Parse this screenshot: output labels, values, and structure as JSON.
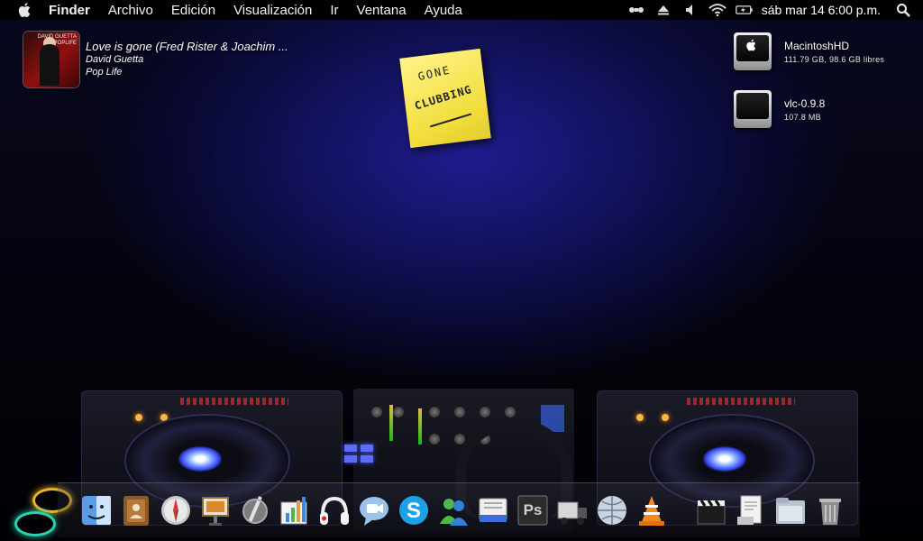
{
  "menubar": {
    "app_name": "Finder",
    "menus": [
      "Archivo",
      "Edición",
      "Visualización",
      "Ir",
      "Ventana",
      "Ayuda"
    ],
    "status_icons": [
      "bluetooth-icon",
      "eject-icon",
      "volume-icon",
      "wifi-icon",
      "battery-icon"
    ],
    "clock": "sáb mar 14  6:00 p.m."
  },
  "now_playing": {
    "title": "Love is gone (Fred Rister & Joachim ...",
    "artist": "David Guetta",
    "album": "Pop Life",
    "art_text": "DAVID GUETTA POPLIFE"
  },
  "sticky_note": {
    "line1": "GONE",
    "line2": "CLUBBING"
  },
  "drives": [
    {
      "name": "MacintoshHD",
      "detail": "111.79 GB, 98.6 GB libres"
    },
    {
      "name": "vlc-0.9.8",
      "detail": "107.8 MB"
    }
  ],
  "dock": {
    "items": [
      "finder-icon",
      "address-book-icon",
      "safari-icon",
      "keynote-icon",
      "script-editor-icon",
      "numbers-icon",
      "headphones-app-icon",
      "ichat-icon",
      "skype-icon",
      "messenger-icon",
      "mail-icon",
      "photoshop-icon",
      "transmit-icon",
      "network-icon",
      "vlc-icon",
      "clapboard-icon",
      "pdf-document-icon",
      "documents-folder-icon",
      "trash-icon"
    ],
    "photoshop_label": "Ps"
  },
  "colors": {
    "wallpaper_glow": "#1f1d8f",
    "sticky_yellow": "#f2de3d",
    "menubar": "#000000",
    "jog_light": "#3a48ff"
  }
}
